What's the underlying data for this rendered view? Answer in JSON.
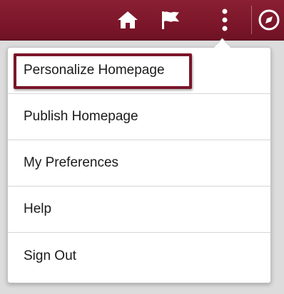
{
  "header": {
    "icons": {
      "home": "home-icon",
      "flag": "flag-icon",
      "more": "more-vertical-icon",
      "navigator": "compass-icon"
    },
    "bar_color": "#7a1529"
  },
  "menu": {
    "items": [
      {
        "label": "Personalize Homepage",
        "highlighted": true
      },
      {
        "label": "Publish Homepage",
        "highlighted": false
      },
      {
        "label": "My Preferences",
        "highlighted": false
      },
      {
        "label": "Help",
        "highlighted": false
      },
      {
        "label": "Sign Out",
        "highlighted": false
      }
    ],
    "highlight_color": "#7a1529"
  }
}
